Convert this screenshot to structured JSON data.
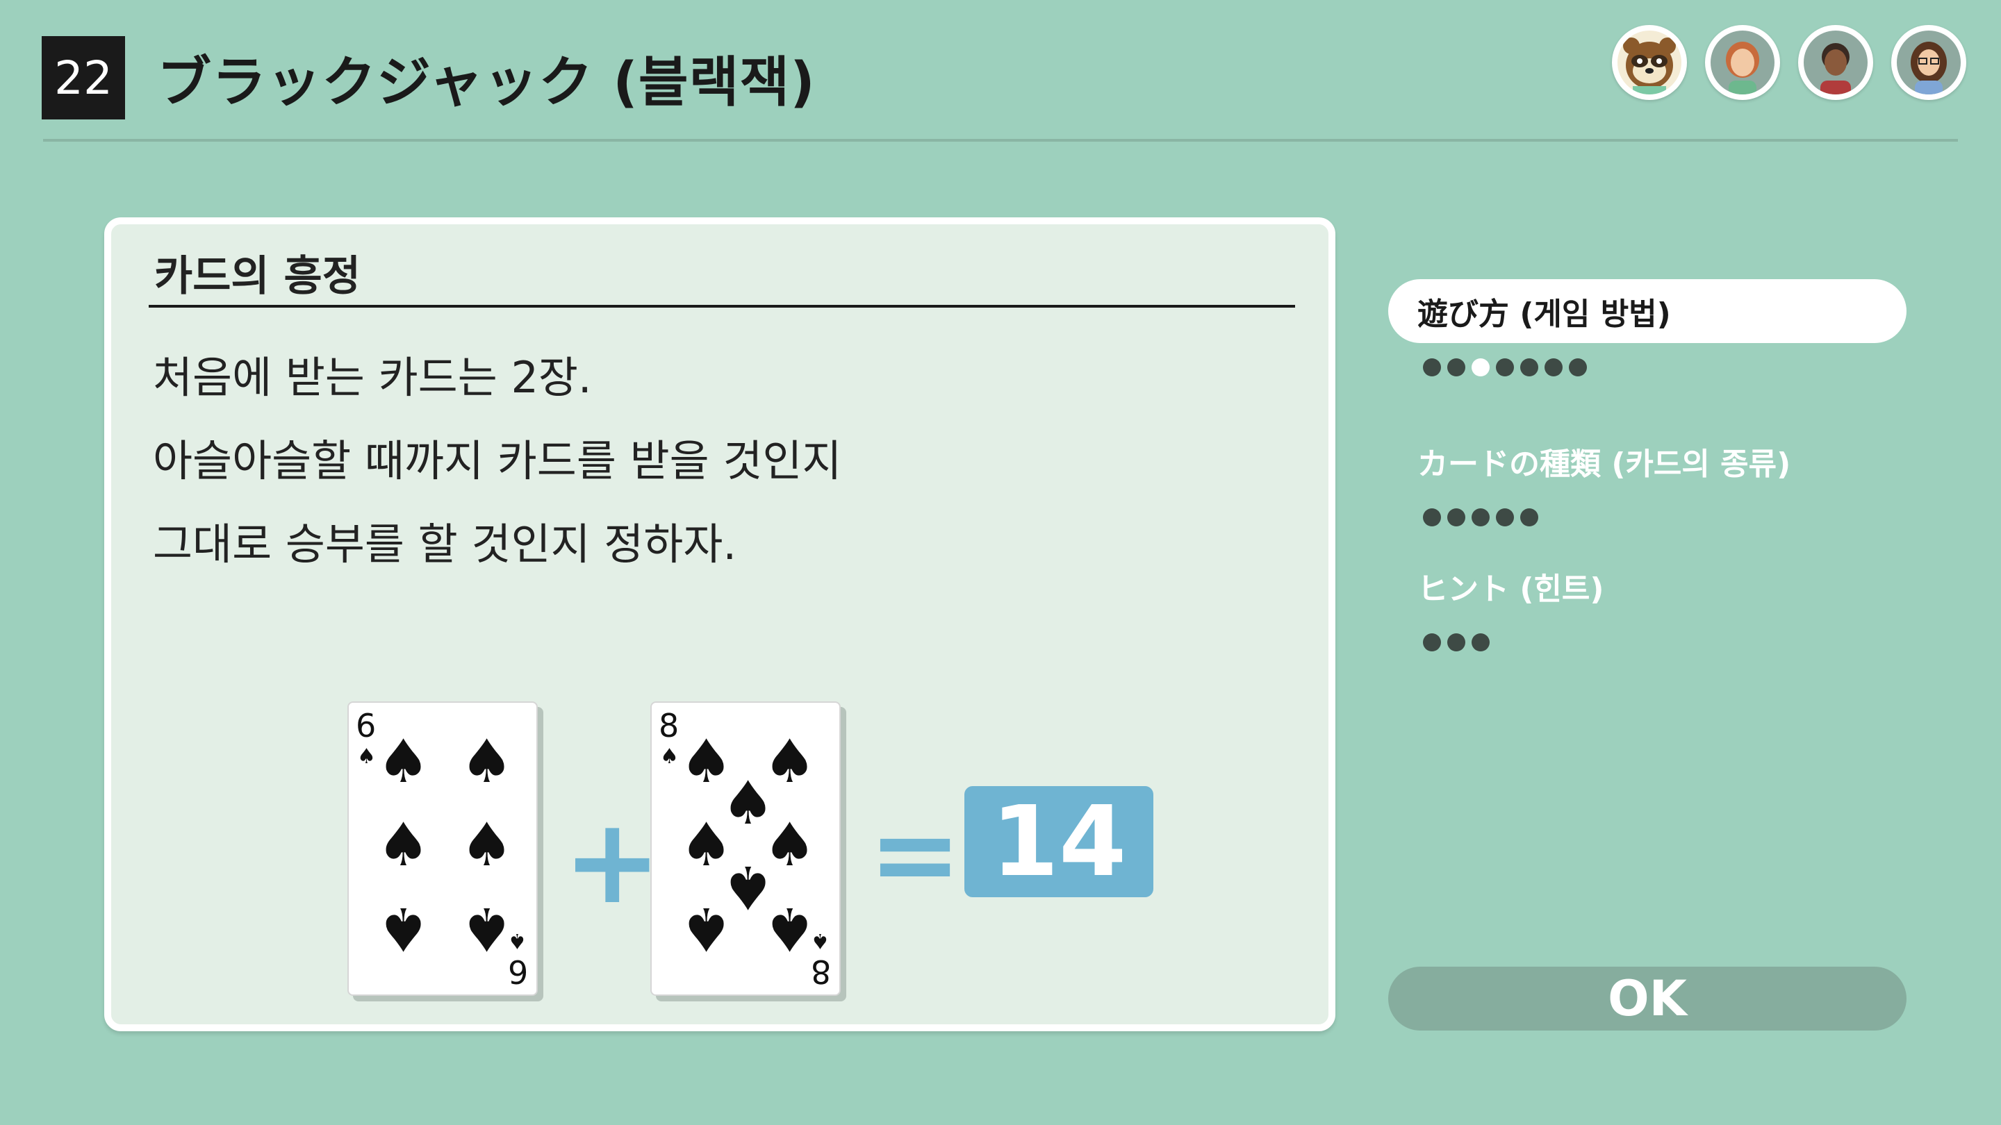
{
  "header": {
    "game_number": "22",
    "title": "ブラックジャック (블랙잭)"
  },
  "players": [
    {
      "name": "raccoon-avatar",
      "color": "#8b5a2b"
    },
    {
      "name": "player-avatar-1",
      "color": "#c86b3c"
    },
    {
      "name": "player-avatar-2",
      "color": "#4a3a32"
    },
    {
      "name": "player-avatar-3",
      "color": "#6b4226"
    }
  ],
  "panel": {
    "title": "카드의 흥정",
    "lines": [
      "처음에 받는 카드는 2장.",
      "아슬아슬할 때까지 카드를 받을 것인지",
      "그대로 승부를 할 것인지 정하자."
    ],
    "cards": [
      {
        "rank": "6",
        "suit": "♠"
      },
      {
        "rank": "8",
        "suit": "♠"
      }
    ],
    "plus": "+",
    "equals": "=",
    "sum": "14"
  },
  "menu": {
    "items": [
      {
        "label": "遊び方 (게임 방법)",
        "active": true,
        "dots": 7,
        "current_dot": 3
      },
      {
        "label": "カードの種類 (카드의 종류)",
        "active": false,
        "dots": 5
      },
      {
        "label": "ヒント (힌트)",
        "active": false,
        "dots": 3
      }
    ],
    "ok_label": "OK"
  },
  "colors": {
    "background": "#9dd0bd",
    "accent": "#6fb4d2",
    "panel": "#e3efe6"
  }
}
